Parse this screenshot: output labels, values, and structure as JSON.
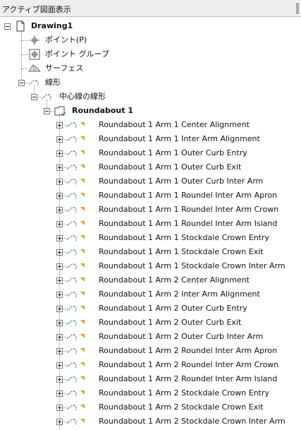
{
  "panel": {
    "title": "アクティブ図面表示"
  },
  "tree": {
    "root": {
      "label": "Drawing1",
      "expander": "minus",
      "icon": "drawing-document-icon"
    },
    "root_children": [
      {
        "label": "ポイント(P)",
        "icon": "point-icon",
        "expander": "none"
      },
      {
        "label": "ポイント グループ",
        "icon": "point-group-icon",
        "expander": "none"
      },
      {
        "label": "サーフェス",
        "icon": "surface-icon",
        "expander": "none"
      },
      {
        "label": "線形",
        "icon": "alignment-icon",
        "expander": "minus"
      }
    ],
    "alignment_group": {
      "label": "中心線の線形",
      "icon": "alignment-icon",
      "expander": "minus"
    },
    "roundabout": {
      "label": "Roundabout 1",
      "icon": "roundabout-folder-icon",
      "expander": "minus"
    },
    "alignments": [
      "Roundabout 1 Arm 1 Center Alignment",
      "Roundabout 1 Arm 1 Inter Arm Alignment",
      "Roundabout 1 Arm 1 Outer Curb Entry",
      "Roundabout 1 Arm 1 Outer Curb Exit",
      "Roundabout 1 Arm 1 Outer Curb Inter Arm",
      "Roundabout 1 Arm 1 Roundel Inter Arm Apron",
      "Roundabout 1 Arm 1 Roundel Inter Arm Crown",
      "Roundabout 1 Arm 1 Roundel Inter Arm Island",
      "Roundabout 1 Arm 1 Stockdale Crown Entry",
      "Roundabout 1 Arm 1 Stockdale Crown Exit",
      "Roundabout 1 Arm 1 Stockdale Crown Inter Arm",
      "Roundabout 1 Arm 2 Center Alignment",
      "Roundabout 1 Arm 2 Inter Arm Alignment",
      "Roundabout 1 Arm 2 Outer Curb Entry",
      "Roundabout 1 Arm 2 Outer Curb Exit",
      "Roundabout 1 Arm 2 Outer Curb Inter Arm",
      "Roundabout 1 Arm 2 Roundel Inter Arm Apron",
      "Roundabout 1 Arm 2 Roundel Inter Arm Crown",
      "Roundabout 1 Arm 2 Roundel Inter Arm Island",
      "Roundabout 1 Arm 2 Stockdale Crown Entry",
      "Roundabout 1 Arm 2 Stockdale Crown Exit",
      "Roundabout 1 Arm 2 Stockdale Crown Inter Arm"
    ],
    "alignment_item_icon": "alignment-icon",
    "alignment_item_expander": "plus"
  },
  "colors": {
    "header_bg": "#eeeeee",
    "tree_line": "#8a8a8a",
    "alignment_icon": "#4a6fa5",
    "marker": "#e0a020",
    "folder_outline": "#444444"
  }
}
